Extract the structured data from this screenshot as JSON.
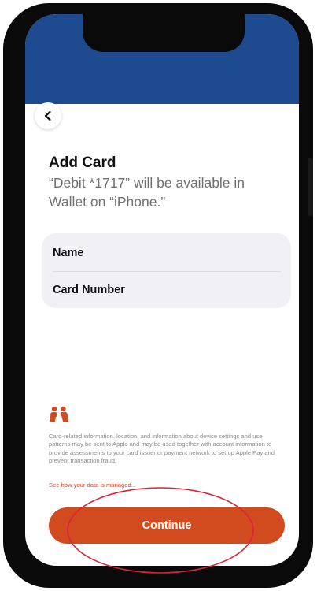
{
  "screen": {
    "header_color": "#1e4a8f",
    "back_icon": "chevron-left-icon",
    "title": "Add Card",
    "subtitle": "“Debit *1717” will be available in Wallet on “iPhone.”"
  },
  "form": {
    "fields": [
      {
        "label": "Name"
      },
      {
        "label": "Card Number"
      }
    ]
  },
  "privacy": {
    "icon": "privacy-handshake-icon",
    "icon_color": "#d24b1f",
    "text": "Card-related information, location, and information about device settings and use patterns may be sent to Apple and may be used together with account information to provide assessments to your card issuer or payment network to set up Apple Pay and prevent transaction fraud.",
    "link": "See how your data is managed..."
  },
  "actions": {
    "continue_label": "Continue",
    "accent_color": "#d24b1f",
    "highlight_color": "#d8253a"
  }
}
